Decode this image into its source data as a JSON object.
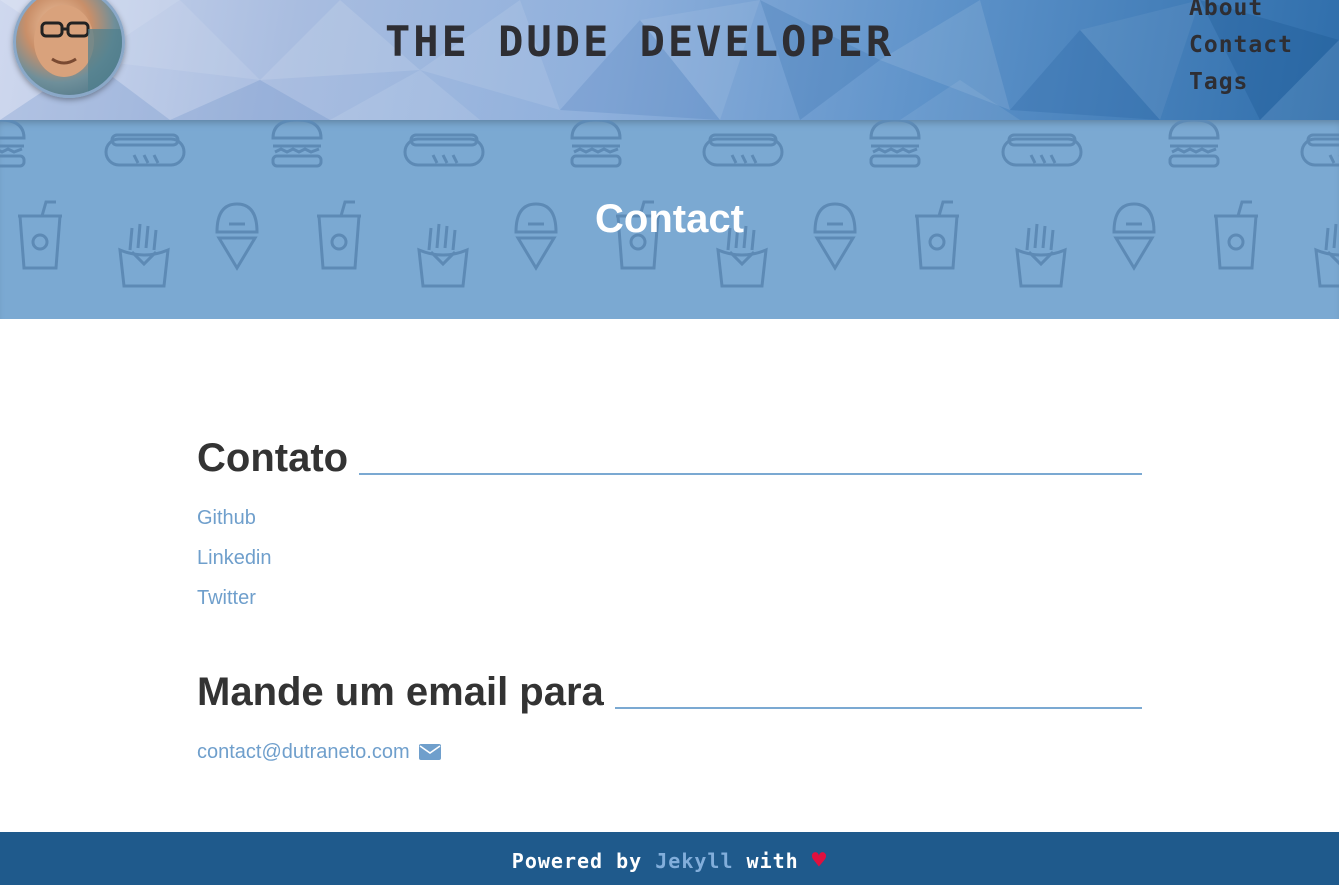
{
  "header": {
    "site_title": "THE DUDE DEVELOPER",
    "nav": [
      {
        "label": "About"
      },
      {
        "label": "Contact"
      },
      {
        "label": "Tags"
      }
    ],
    "avatar_icon": "avatar-photo"
  },
  "hero": {
    "title": "Contact",
    "background_color": "#7ba9d2",
    "pattern_icons": [
      "burger-icon",
      "hotdog-icon",
      "soda-cup-icon",
      "ice-cream-icon",
      "fries-icon"
    ]
  },
  "main": {
    "contact_section": {
      "heading": "Contato",
      "links": [
        {
          "label": "Github"
        },
        {
          "label": "Linkedin"
        },
        {
          "label": "Twitter"
        }
      ]
    },
    "email_section": {
      "heading": "Mande um email para",
      "email": "contact@dutraneto.com",
      "icon": "envelope-icon"
    }
  },
  "footer": {
    "prefix": "Powered by",
    "link": "Jekyll",
    "suffix": "with",
    "heart": "♥"
  },
  "colors": {
    "accent": "#7ba9d2",
    "link": "#6f9fcc",
    "footer_bg": "#1f5a8c",
    "heart": "#e0103e",
    "heading": "#333333"
  }
}
